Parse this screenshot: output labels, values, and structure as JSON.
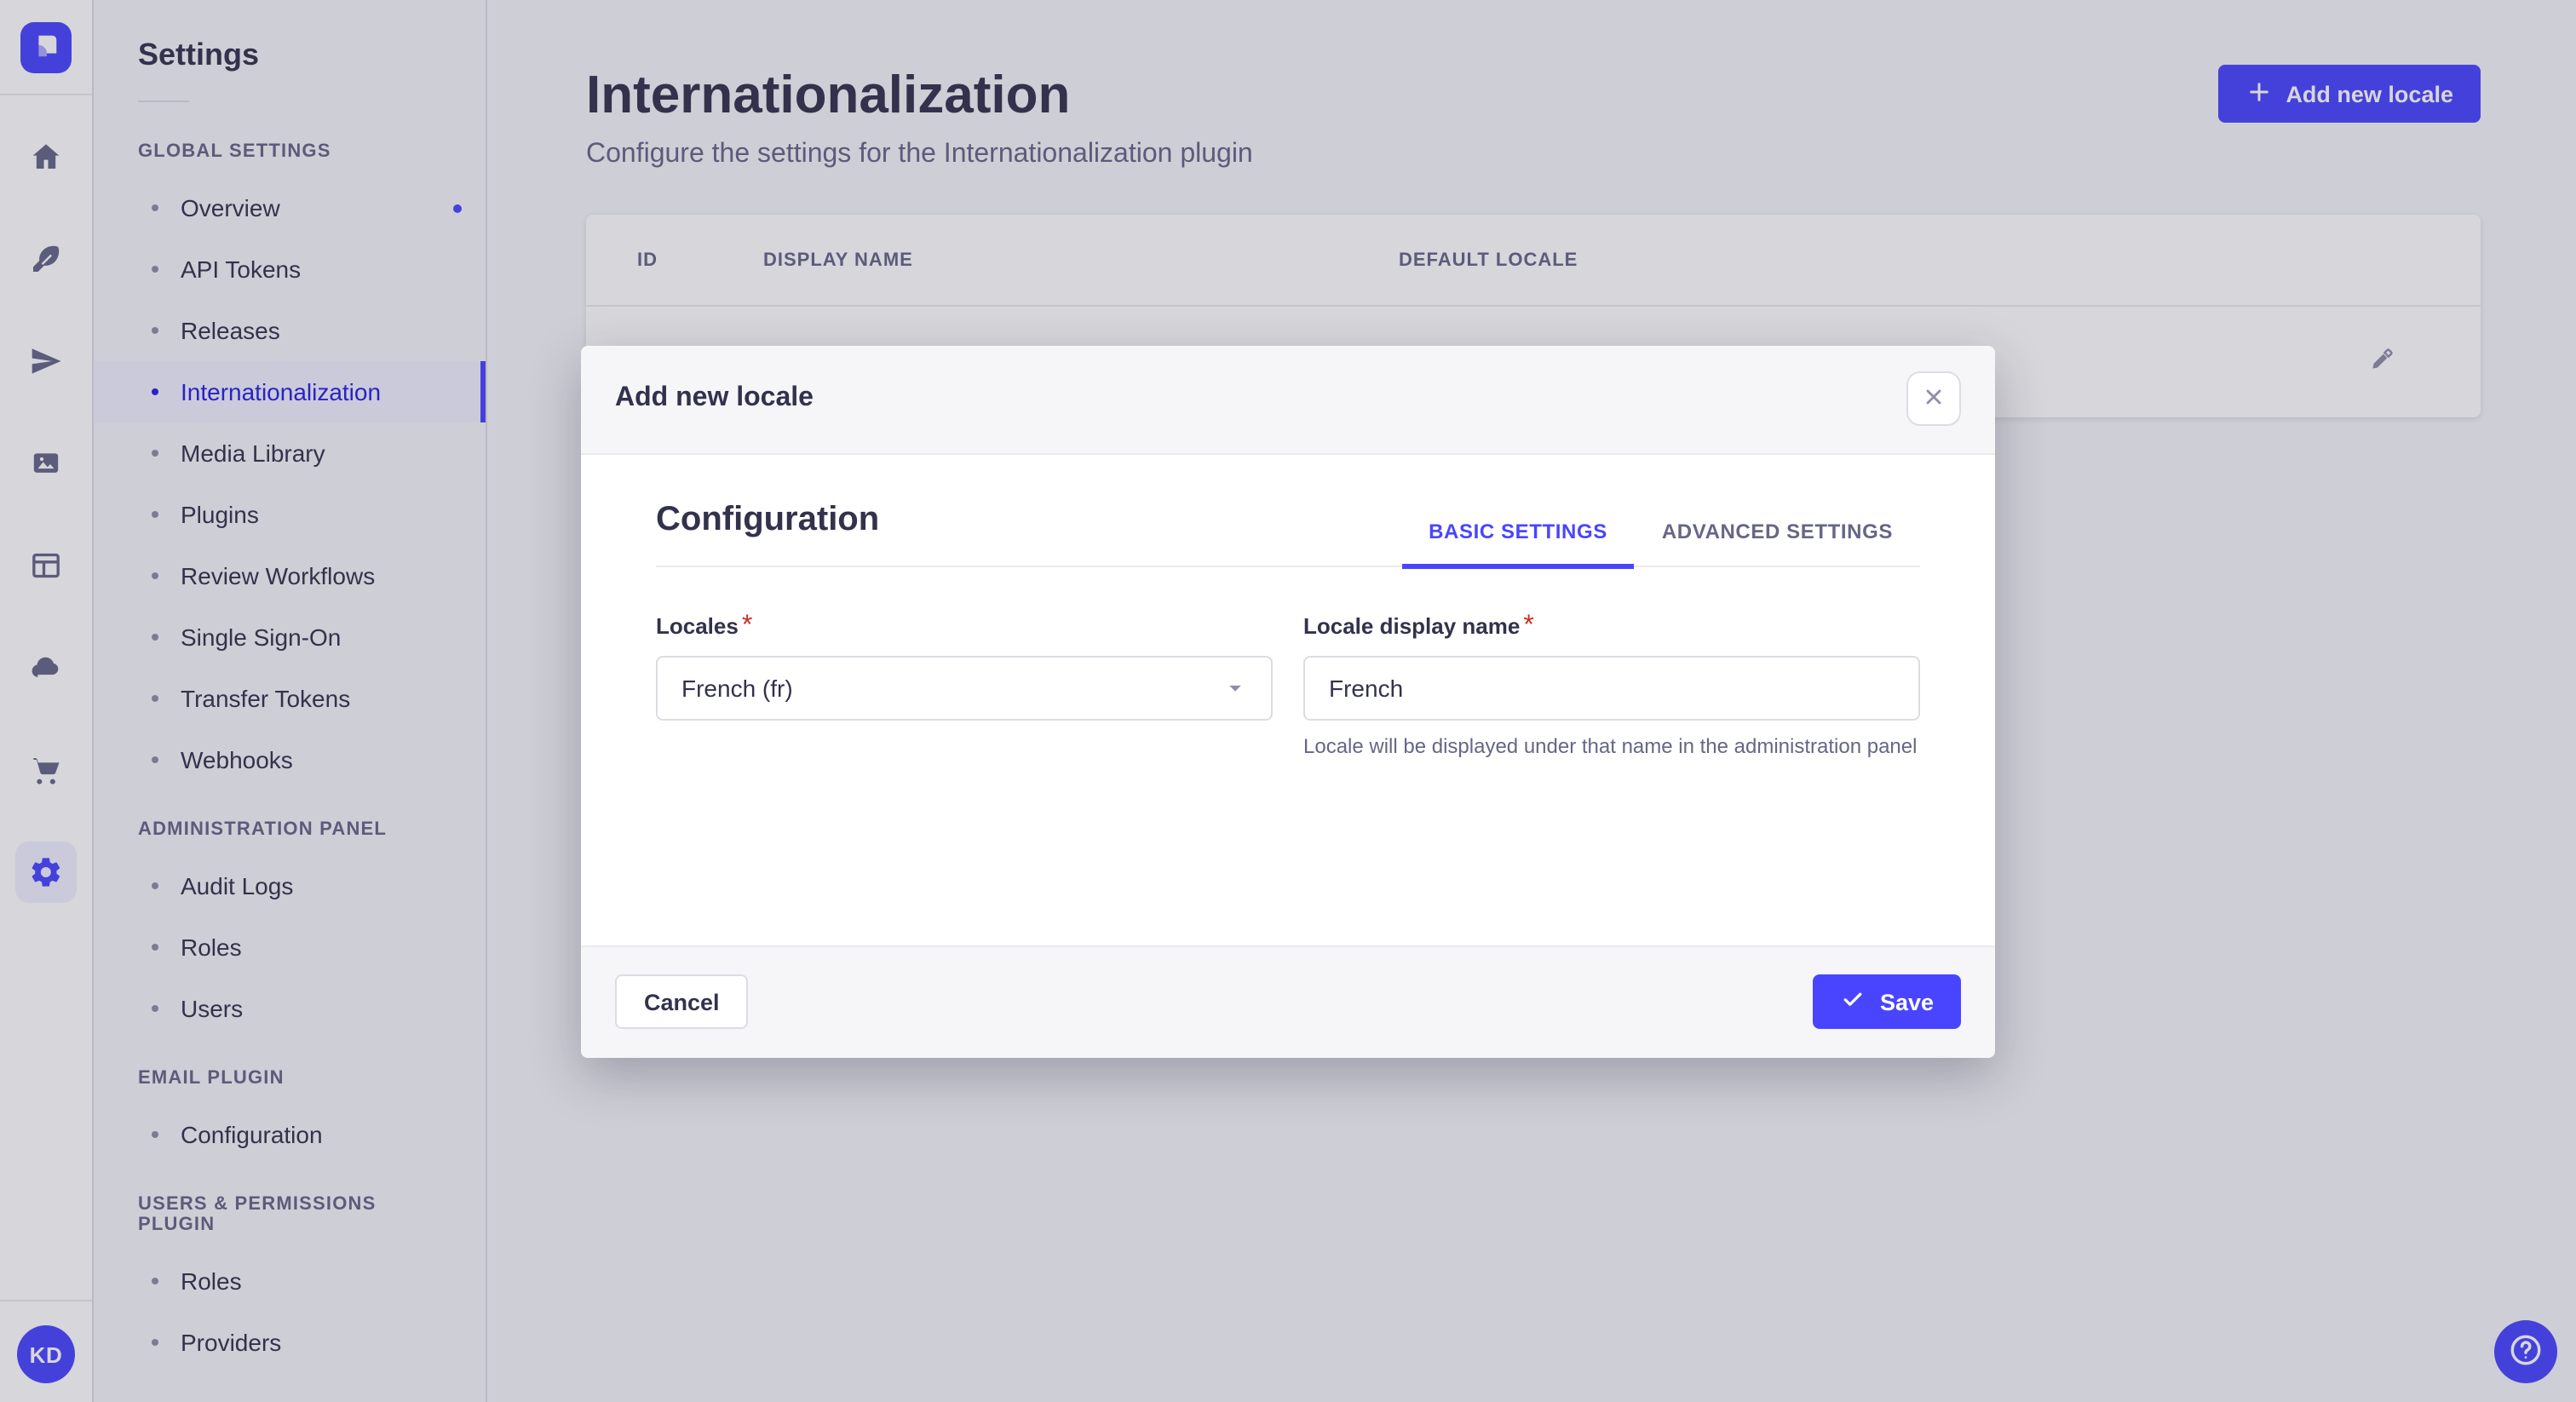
{
  "app": {
    "accent_color": "#4945ff",
    "overlay_color": "rgba(50,50,77,0.2)"
  },
  "nav_rail": {
    "logo_icon": "strapi-logo",
    "icons": [
      {
        "name": "home"
      },
      {
        "name": "feather"
      },
      {
        "name": "send"
      },
      {
        "name": "media"
      },
      {
        "name": "layout"
      },
      {
        "name": "cloud"
      },
      {
        "name": "cart"
      },
      {
        "name": "gear",
        "active": true
      }
    ],
    "avatar_initials": "KD"
  },
  "sidebar": {
    "title": "Settings",
    "sections": [
      {
        "label": "GLOBAL SETTINGS",
        "items": [
          {
            "label": "Overview",
            "notification": true
          },
          {
            "label": "API Tokens"
          },
          {
            "label": "Releases"
          },
          {
            "label": "Internationalization",
            "active": true
          },
          {
            "label": "Media Library"
          },
          {
            "label": "Plugins"
          },
          {
            "label": "Review Workflows"
          },
          {
            "label": "Single Sign-On"
          },
          {
            "label": "Transfer Tokens"
          },
          {
            "label": "Webhooks"
          }
        ]
      },
      {
        "label": "ADMINISTRATION PANEL",
        "items": [
          {
            "label": "Audit Logs"
          },
          {
            "label": "Roles"
          },
          {
            "label": "Users"
          }
        ]
      },
      {
        "label": "EMAIL PLUGIN",
        "items": [
          {
            "label": "Configuration"
          }
        ]
      },
      {
        "label": "USERS & PERMISSIONS PLUGIN",
        "items": [
          {
            "label": "Roles"
          },
          {
            "label": "Providers"
          }
        ]
      }
    ]
  },
  "main": {
    "title": "Internationalization",
    "subtitle": "Configure the settings for the Internationalization plugin",
    "add_button_label": "Add new locale",
    "table": {
      "headers": [
        "ID",
        "DISPLAY NAME",
        "DEFAULT LOCALE"
      ],
      "row_action_icon": "pencil-icon"
    },
    "help_icon": "question-mark-icon"
  },
  "modal": {
    "title": "Add new locale",
    "section_title": "Configuration",
    "tabs": [
      {
        "label": "BASIC SETTINGS",
        "active": true
      },
      {
        "label": "ADVANCED SETTINGS",
        "active": false
      }
    ],
    "fields": {
      "locales": {
        "label": "Locales",
        "required": "*",
        "value": "French (fr)"
      },
      "display_name": {
        "label": "Locale display name",
        "required": "*",
        "value": "French",
        "hint": "Locale will be displayed under that name in the administration panel"
      }
    },
    "cancel_label": "Cancel",
    "save_label": "Save"
  }
}
